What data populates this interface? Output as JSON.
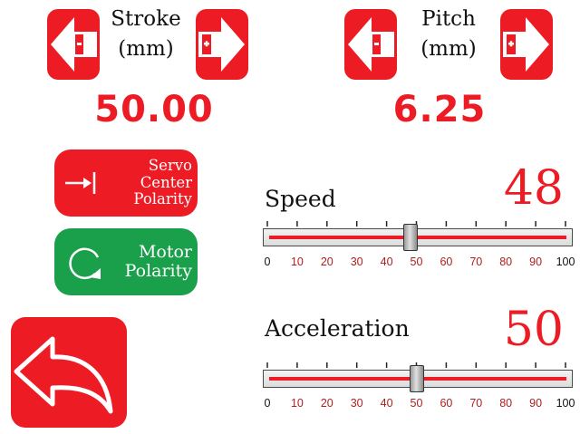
{
  "stroke": {
    "label_line1": "Stroke",
    "label_line2": "(mm)",
    "value": "50.00",
    "decrease_icon": "arrow-left-minus-icon",
    "increase_icon": "arrow-right-plus-icon"
  },
  "pitch": {
    "label_line1": "Pitch",
    "label_line2": "(mm)",
    "value": "6.25",
    "decrease_icon": "arrow-left-minus-icon",
    "increase_icon": "arrow-right-plus-icon"
  },
  "buttons": {
    "servo": {
      "lines": [
        "Servo",
        "Center",
        "Polarity"
      ],
      "icon": "center-polarity-icon",
      "color": "#ed1c24"
    },
    "motor": {
      "lines": [
        "Motor",
        "Polarity"
      ],
      "icon": "rotate-icon",
      "color": "#1aa04a"
    },
    "back": {
      "icon": "back-arrow-icon",
      "color": "#ed1c24"
    }
  },
  "speed": {
    "label": "Speed",
    "value": "48",
    "level": 48
  },
  "acceleration": {
    "label": "Acceleration",
    "value": "50",
    "level": 50
  },
  "scale": {
    "min": 0,
    "max": 100,
    "labels": [
      "0",
      "10",
      "20",
      "30",
      "40",
      "50",
      "60",
      "70",
      "80",
      "90",
      "100"
    ]
  },
  "colors": {
    "accent_red": "#ed1c24",
    "accent_green": "#1aa04a"
  }
}
